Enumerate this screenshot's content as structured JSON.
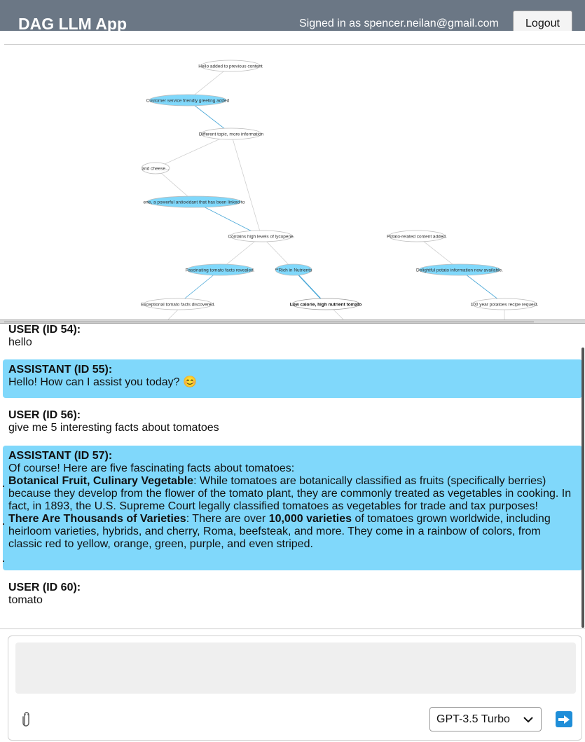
{
  "header": {
    "title": "DAG LLM App",
    "signed_in_text": "Signed in as spencer.neilan@gmail.com",
    "logout_label": "Logout"
  },
  "graph": {
    "nodes": [
      {
        "label": "Hello added to previous content",
        "highlighted": false,
        "bold": false
      },
      {
        "label": "Customer service friendly greeting added",
        "highlighted": true,
        "bold": false
      },
      {
        "label": "Different topic, more information",
        "highlighted": false,
        "bold": false
      },
      {
        "label": "and cheese...",
        "highlighted": false,
        "bold": false
      },
      {
        "label": "ene, a powerful antioxidant that has been linked to",
        "highlighted": true,
        "bold": false
      },
      {
        "label": "Contains high levels of lycopene.",
        "highlighted": false,
        "bold": false
      },
      {
        "label": "Potato-related content added.",
        "highlighted": false,
        "bold": false
      },
      {
        "label": "Fascinating tomato facts revealed.",
        "highlighted": true,
        "bold": false
      },
      {
        "label": "**Rich in Nutrients",
        "highlighted": true,
        "bold": false
      },
      {
        "label": "Delightful potato information now available.",
        "highlighted": true,
        "bold": false
      },
      {
        "label": "Exceptional tomato facts discovered.",
        "highlighted": false,
        "bold": false
      },
      {
        "label": "Low calorie, high nutrient tomato",
        "highlighted": false,
        "bold": true
      },
      {
        "label": "100 year potatoes recipe request.",
        "highlighted": false,
        "bold": false
      }
    ],
    "colors": {
      "highlight": "#80d8fb",
      "edge": "#d0d0d0",
      "edge_active": "#4aa8d8"
    }
  },
  "chat": {
    "messages": [
      {
        "role": "USER (ID 54):",
        "lines": [
          "hello"
        ]
      },
      {
        "role": "ASSISTANT (ID 55):",
        "text": "Hello! How can I assist you today? 😊"
      },
      {
        "role": "USER (ID 56):",
        "text": "give me 5 interesting facts about tomatoes"
      },
      {
        "role": "ASSISTANT (ID 57):",
        "intro": "Of course! Here are five fascinating facts about tomatoes:",
        "fact1_title": "Botanical Fruit, Culinary Vegetable",
        "fact1_body": ": While tomatoes are botanically classified as fruits (specifically berries) because they develop from the flower of the tomato plant, they are commonly treated as vegetables in cooking. In fact, in 1893, the U.S. Supreme Court legally classified tomatoes as vegetables for trade and tax purposes!",
        "fact2_title": "There Are Thousands of Varieties",
        "fact2_mid": ": There are over ",
        "fact2_bold": "10,000 varieties",
        "fact2_end": " of tomatoes grown worldwide, including heirloom varieties, hybrids, and cherry, Roma, beefsteak, and more. They come in a rainbow of colors, from classic red to yellow, orange, green, purple, and even striped."
      },
      {
        "role": "USER (ID 60):",
        "text": "tomato"
      }
    ],
    "colors": {
      "assistant_bg": "#80d8fb"
    }
  },
  "composer": {
    "input_value": "",
    "model_selected": "GPT-3.5 Turbo",
    "attach_icon": "paperclip-icon",
    "send_icon": "arrow-right-icon",
    "send_color": "#1f8ed8"
  }
}
